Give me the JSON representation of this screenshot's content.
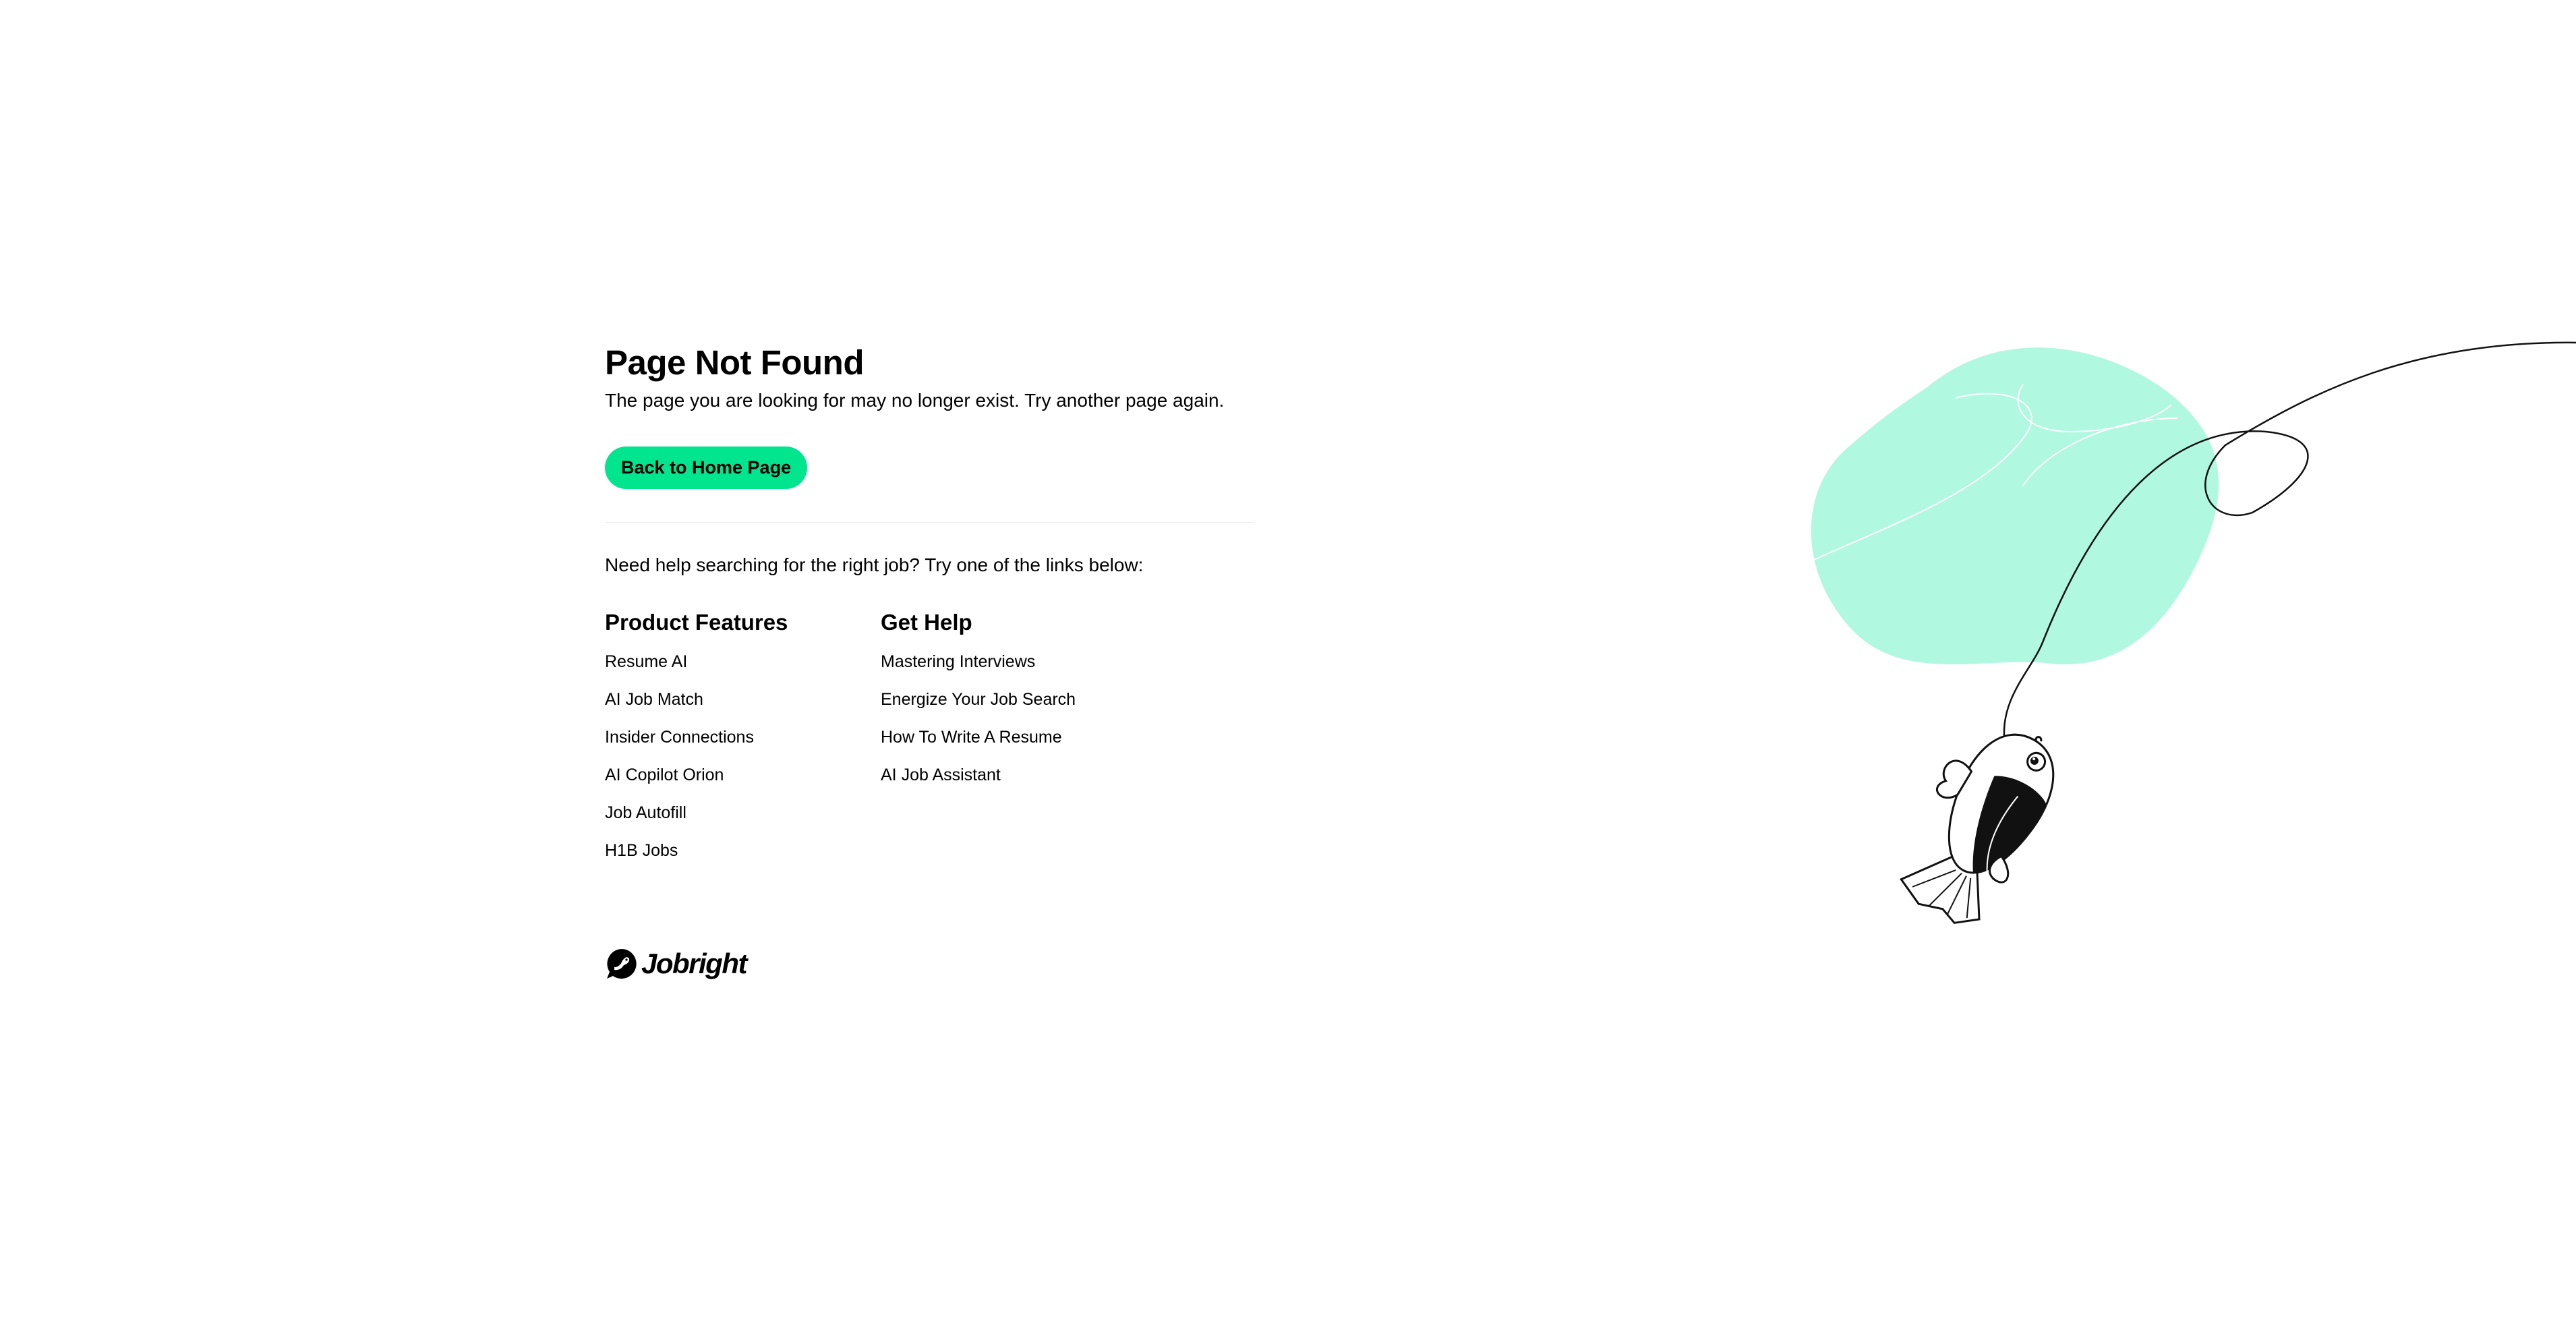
{
  "error": {
    "title": "Page Not Found",
    "message": "The page you are looking for may no longer exist. Try another page again.",
    "home_button_label": "Back to Home Page"
  },
  "help": {
    "prompt": "Need help searching for the right job? Try one of the links below:"
  },
  "product_features": {
    "heading": "Product Features",
    "links": [
      "Resume AI",
      "AI Job Match",
      "Insider Connections",
      "AI Copilot Orion",
      "Job Autofill",
      "H1B Jobs"
    ]
  },
  "get_help": {
    "heading": "Get Help",
    "links": [
      "Mastering Interviews",
      "Energize Your Job Search",
      "How To Write A Resume",
      "AI Job Assistant"
    ]
  },
  "brand": {
    "logo_text": "Jobright"
  },
  "colors": {
    "accent": "#00e58e",
    "illustration_blob": "#b0f8df"
  },
  "icons": {
    "illustration": "fish-on-hook-illustration",
    "logo": "jobright-logo-icon"
  }
}
